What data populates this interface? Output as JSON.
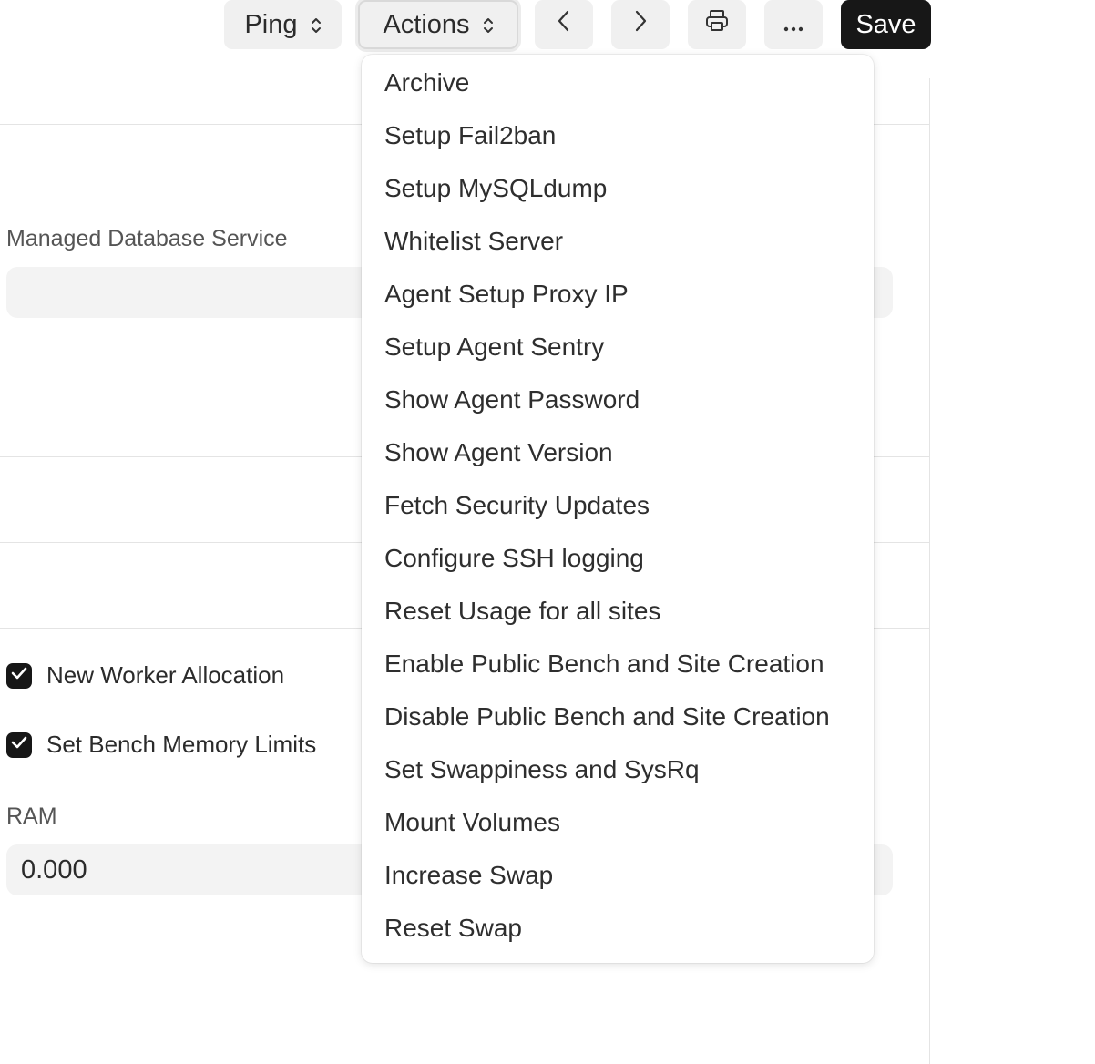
{
  "toolbar": {
    "ping_label": "Ping",
    "actions_label": "Actions",
    "save_label": "Save",
    "more_label": "···"
  },
  "form": {
    "managed_db_label": "Managed Database Service",
    "managed_db_value": "",
    "new_worker_label": "New Worker Allocation",
    "new_worker_checked": true,
    "bench_memory_label": "Set Bench Memory Limits",
    "bench_memory_checked": true,
    "ram_label": "RAM",
    "ram_value": "0.000"
  },
  "actions_menu": {
    "items": [
      "Archive",
      "Setup Fail2ban",
      "Setup MySQLdump",
      "Whitelist Server",
      "Agent Setup Proxy IP",
      "Setup Agent Sentry",
      "Show Agent Password",
      "Show Agent Version",
      "Fetch Security Updates",
      "Configure SSH logging",
      "Reset Usage for all sites",
      "Enable Public Bench and Site Creation",
      "Disable Public Bench and Site Creation",
      "Set Swappiness and SysRq",
      "Mount Volumes",
      "Increase Swap",
      "Reset Swap"
    ]
  },
  "icons": {
    "prev": "chevron-left-icon",
    "next": "chevron-right-icon",
    "print": "printer-icon",
    "more": "ellipsis-icon",
    "select": "select-updown-icon",
    "check": "check-icon"
  },
  "colors": {
    "primary_button": "#171717",
    "button_bg": "#f0f0f0",
    "input_bg": "#f3f3f3",
    "divider": "#e4e4e4"
  }
}
